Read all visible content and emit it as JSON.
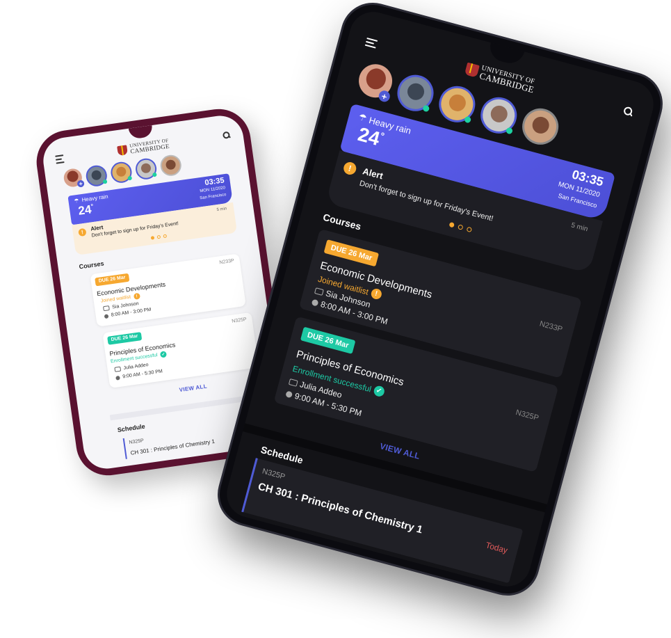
{
  "brand": {
    "line1": "UNIVERSITY OF",
    "line2": "CAMBRIDGE"
  },
  "weather": {
    "condition": "Heavy rain",
    "temperature": "24",
    "degree": "°",
    "time": "03:35",
    "date": "MON 11/2020",
    "city": "San Francisco"
  },
  "alert": {
    "title": "Alert",
    "message": "Don't forget to sign up for Friday's Event!",
    "age": "5 min"
  },
  "courses": {
    "title": "Courses",
    "items": [
      {
        "due": "DUE 26 Mar",
        "code": "N233P",
        "name": "Economic Developments",
        "status": "Joined waitlist",
        "status_mark": "!",
        "instructor": "Sia Johnson",
        "time": "8:00 AM - 3:00 PM"
      },
      {
        "due": "DUE 26 Mar",
        "code": "N325P",
        "name": "Principles of Economics",
        "status": "Enrollment successful",
        "status_mark": "✓",
        "instructor": "Julia Addeo",
        "time": "9:00 AM - 5:30 PM"
      }
    ],
    "view_all": "VIEW ALL"
  },
  "schedule": {
    "title": "Schedule",
    "code": "N325P",
    "when": "Today",
    "course": "CH 301 : Principles of Chemistry 1",
    "course_partial": "CH 301 : Principles of Chemistry 1"
  },
  "colors": {
    "accent": "#4f5bd5",
    "orange": "#f6a830",
    "teal": "#1dc9a4",
    "today": "#e05a5a"
  },
  "icons": [
    "menu-icon",
    "search-icon",
    "cloud-rain-icon",
    "alert-icon",
    "person-board-icon",
    "clock-icon",
    "check-icon",
    "add-icon"
  ]
}
